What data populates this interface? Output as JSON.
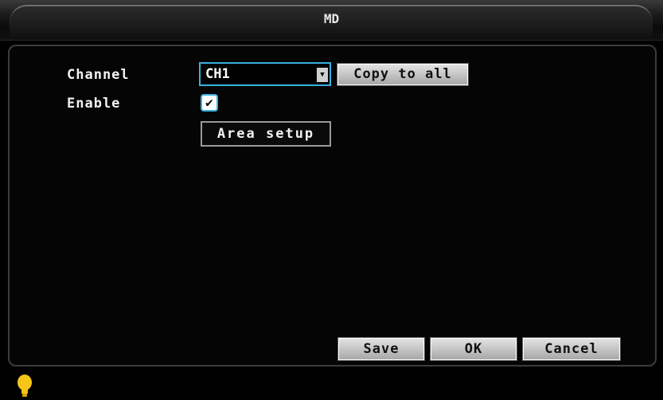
{
  "window": {
    "title": "MD"
  },
  "form": {
    "channel_label": "Channel",
    "channel_value": "CH1",
    "copy_to_all_label": "Copy to all",
    "enable_label": "Enable",
    "enable_checked": true,
    "area_setup_label": "Area setup"
  },
  "footer": {
    "save_label": "Save",
    "ok_label": "OK",
    "cancel_label": "Cancel"
  },
  "icons": {
    "dropdown": "chevron-down-icon",
    "check": "check-icon",
    "status": "lightbulb-icon"
  },
  "colors": {
    "focus_border": "#3ab0e0",
    "bulb": "#f5c518"
  }
}
